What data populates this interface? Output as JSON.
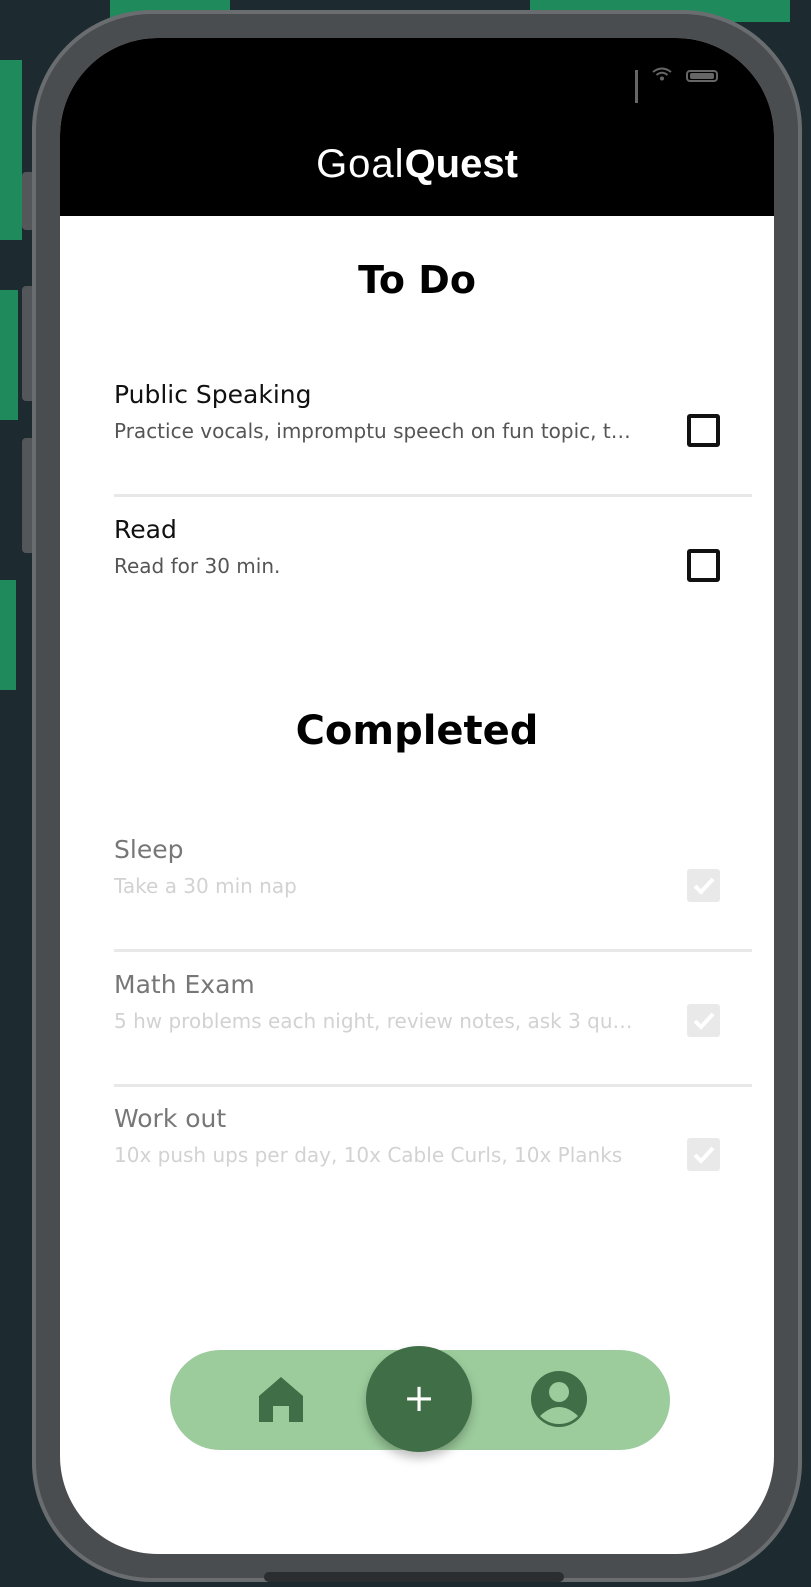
{
  "app": {
    "brand_light": "Goal",
    "brand_bold": "Quest"
  },
  "todo": {
    "heading": "To Do",
    "items": [
      {
        "title": "Public Speaking",
        "desc": "Practice vocals, impromptu speech on fun topic, t…",
        "checked": false
      },
      {
        "title": "Read",
        "desc": "Read for 30 min.",
        "checked": false
      }
    ]
  },
  "completed": {
    "heading": "Completed",
    "items": [
      {
        "title": "Sleep",
        "desc": "Take a 30 min nap",
        "checked": true
      },
      {
        "title": "Math Exam",
        "desc": "5 hw problems each night, review notes, ask 3 qu…",
        "checked": true
      },
      {
        "title": "Work out",
        "desc": "10x push ups per day, 10x Cable Curls, 10x Planks",
        "checked": true
      }
    ]
  },
  "nav": {
    "add_label": "+",
    "home_icon": "home-icon",
    "profile_icon": "account-circle-icon"
  },
  "colors": {
    "nav_bar": "#9ccc9c",
    "fab": "#3f6e47",
    "nav_icon": "#3f6e47",
    "topbar": "#000000"
  }
}
